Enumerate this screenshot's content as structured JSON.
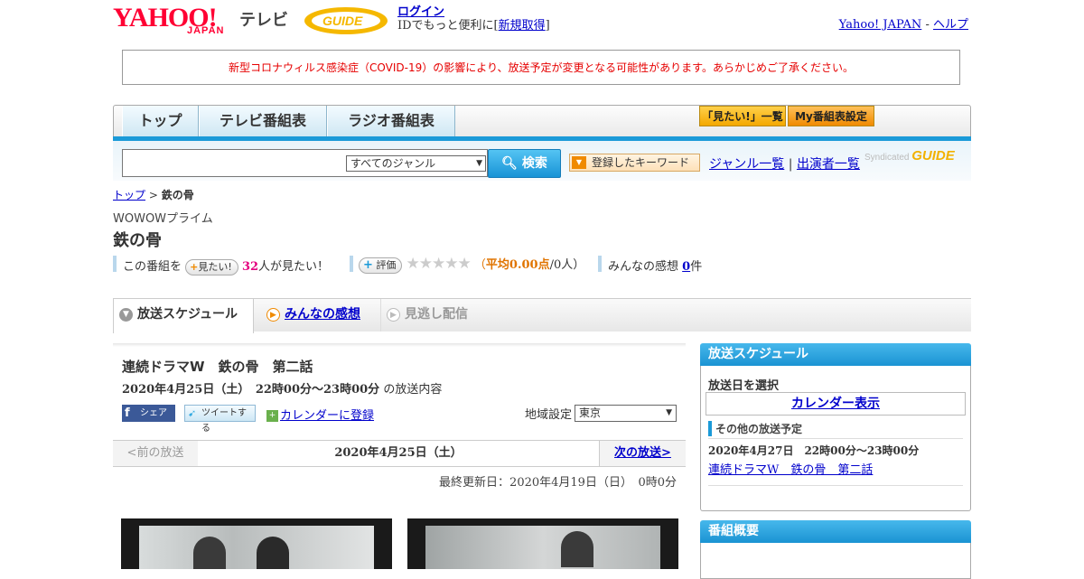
{
  "header": {
    "logo_yahoo": "YAHOO!",
    "logo_japan": "JAPAN",
    "logo_tv": "テレビ",
    "logo_gguide": "GUIDE",
    "login_label": "ログイン",
    "login_sub_prefix": "IDでもっと便利に[",
    "signup_label": "新規取得",
    "login_sub_suffix": "]",
    "yahoo_japan_link": "Yahoo! JAPAN",
    "separator": "-",
    "help_link": "ヘルプ"
  },
  "notice": "新型コロナウィルス感染症（COVID-19）の影響により、放送予定が変更となる可能性があります。あらかじめご了承ください。",
  "nav": {
    "tabs": [
      "トップ",
      "テレビ番組表",
      "ラジオ番組表"
    ],
    "mitai_list": "「見たい!」一覧",
    "my_settings": "My番組表設定"
  },
  "search": {
    "input_value": "",
    "genre_selected": "すべてのジャンル",
    "search_button": "検索",
    "keyword_button": "登録したキーワード",
    "genre_list_link": "ジャンル一覧",
    "link_separator": "|",
    "performer_list_link": "出演者一覧",
    "syndicated_label": "Syndicated",
    "syndicated_brand": "GUIDE"
  },
  "breadcrumb": {
    "top": "トップ",
    "sep": ">",
    "current": "鉄の骨"
  },
  "program": {
    "station": "WOWOWプライム",
    "title": "鉄の骨",
    "wants_prefix": "この番組を",
    "mitai_button": "見たい!",
    "wants_count": "32",
    "wants_suffix": "人が見たい！",
    "rate_button": "評価",
    "rating_stars": 0,
    "rating_open": "（",
    "rating_avg": "平均0.00点",
    "rating_count": "/0人）",
    "impressions_prefix": "みんなの感想",
    "impressions_count": "0",
    "impressions_suffix": "件"
  },
  "tabs": {
    "schedule": "放送スケジュール",
    "impressions": "みんなの感想",
    "catchup": "見逃し配信"
  },
  "episode": {
    "title": "連続ドラマW　鉄の骨　第二話",
    "datetime": "2020年4月25日（土）　22時00分～23時00分",
    "datetime_suffix": "の放送内容",
    "share_fb": "シェア",
    "tweet": "ツイートする",
    "calendar_register": "カレンダーに登録",
    "region_label": "地域設定",
    "region_selected": "東京",
    "prev": "<前の放送",
    "current_date": "2020年4月25日（土）",
    "next": "次の放送>",
    "updated": "最終更新日：2020年4月19日（日）　0時0分"
  },
  "sidebar": {
    "schedule_head": "放送スケジュール",
    "select_date": "放送日を選択",
    "calendar_button": "カレンダー表示",
    "other_head": "その他の放送予定",
    "other_date": "2020年4月27日　22時00分～23時00分",
    "other_link": "連続ドラマW　鉄の骨　第二話",
    "overview_head": "番組概要"
  },
  "colors": {
    "accent_blue": "#1b9ad8",
    "notice_red": "#e60000",
    "link_blue": "#0000cc",
    "wants_pink": "#e4007f",
    "rating_orange": "#e07400"
  }
}
